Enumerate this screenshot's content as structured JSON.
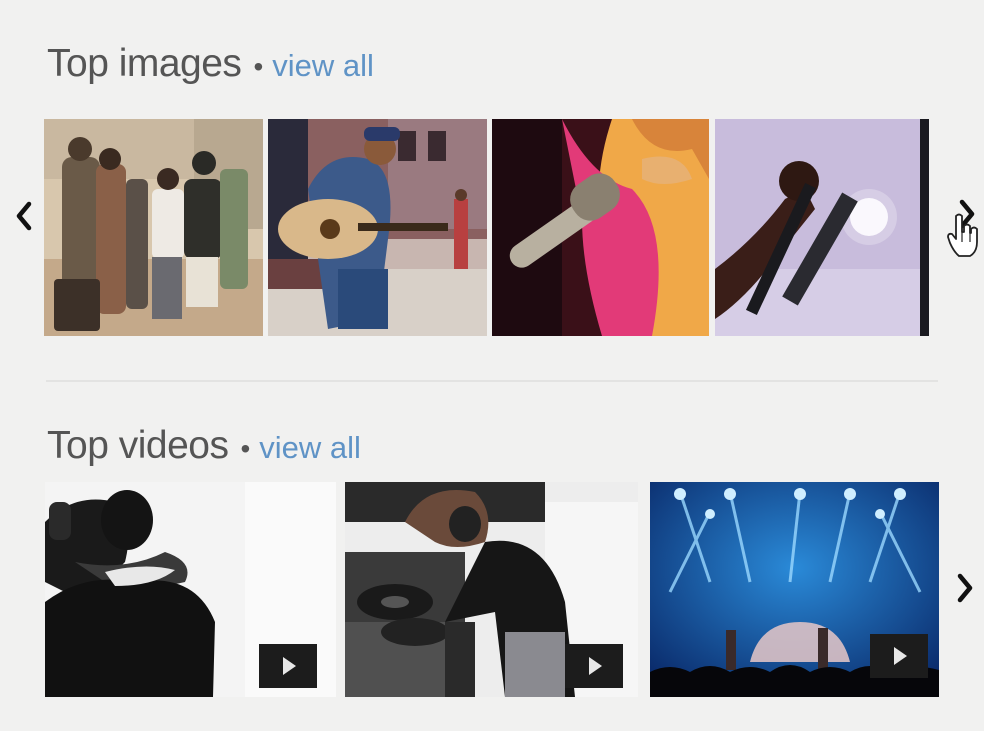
{
  "top_images": {
    "title": "Top images",
    "separator": "•",
    "view_all": "view all",
    "thumbnails": [
      {
        "subject": "street musicians group photo"
      },
      {
        "subject": "man playing acoustic guitar on street"
      },
      {
        "subject": "singer with microphone close-up"
      },
      {
        "subject": "performer holding microphone on stage"
      }
    ]
  },
  "top_videos": {
    "title": "Top videos",
    "separator": "•",
    "view_all": "view all",
    "thumbnails": [
      {
        "subject": "black and white singer with microphone"
      },
      {
        "subject": "DJ with headphones at turntables"
      },
      {
        "subject": "concert stage with blue lights"
      }
    ]
  },
  "icons": {
    "prev": "chevron-left-icon",
    "next": "chevron-right-icon",
    "play": "play-icon",
    "cursor": "hand-pointer-icon"
  },
  "colors": {
    "background": "#f1f1f0",
    "heading": "#555555",
    "link": "#5f93c6"
  }
}
